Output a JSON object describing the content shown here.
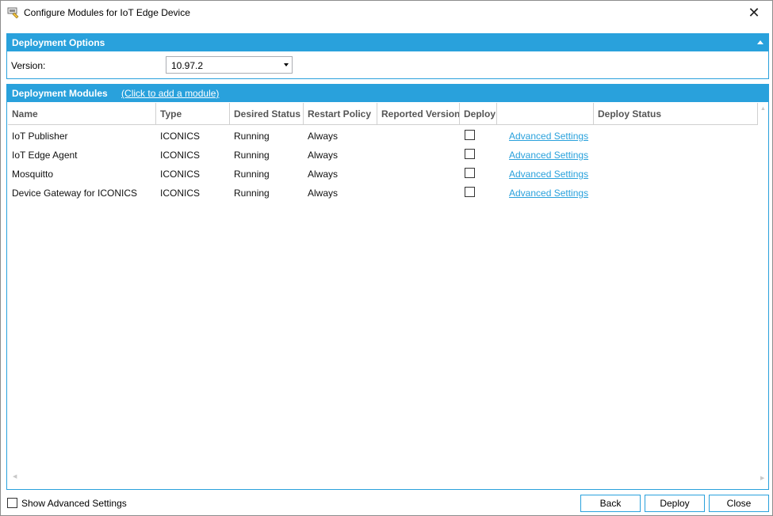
{
  "window": {
    "title": "Configure Modules for IoT Edge Device",
    "close_glyph": "✕"
  },
  "deployment_options": {
    "header": "Deployment Options",
    "version_label": "Version:",
    "version_value": "10.97.2"
  },
  "deployment_modules": {
    "header": "Deployment Modules",
    "add_link": "(Click to add a module)",
    "columns": [
      "Name",
      "Type",
      "Desired Status",
      "Restart Policy",
      "Reported Version",
      "Deploy",
      "",
      "Deploy Status"
    ],
    "rows": [
      {
        "name": "IoT Publisher",
        "type": "ICONICS",
        "desired_status": "Running",
        "restart_policy": "Always",
        "reported_version": "",
        "deploy": false,
        "settings_link": "Advanced Settings",
        "deploy_status": ""
      },
      {
        "name": "IoT Edge Agent",
        "type": "ICONICS",
        "desired_status": "Running",
        "restart_policy": "Always",
        "reported_version": "",
        "deploy": false,
        "settings_link": "Advanced Settings",
        "deploy_status": ""
      },
      {
        "name": "Mosquitto",
        "type": "ICONICS",
        "desired_status": "Running",
        "restart_policy": "Always",
        "reported_version": "",
        "deploy": false,
        "settings_link": "Advanced Settings",
        "deploy_status": ""
      },
      {
        "name": "Device Gateway for ICONICS",
        "type": "ICONICS",
        "desired_status": "Running",
        "restart_policy": "Always",
        "reported_version": "",
        "deploy": false,
        "settings_link": "Advanced Settings",
        "deploy_status": ""
      }
    ]
  },
  "footer": {
    "show_advanced_label": "Show Advanced Settings",
    "show_advanced_checked": false,
    "back_label": "Back",
    "deploy_label": "Deploy",
    "close_label": "Close"
  },
  "colors": {
    "accent": "#29a1dc"
  }
}
